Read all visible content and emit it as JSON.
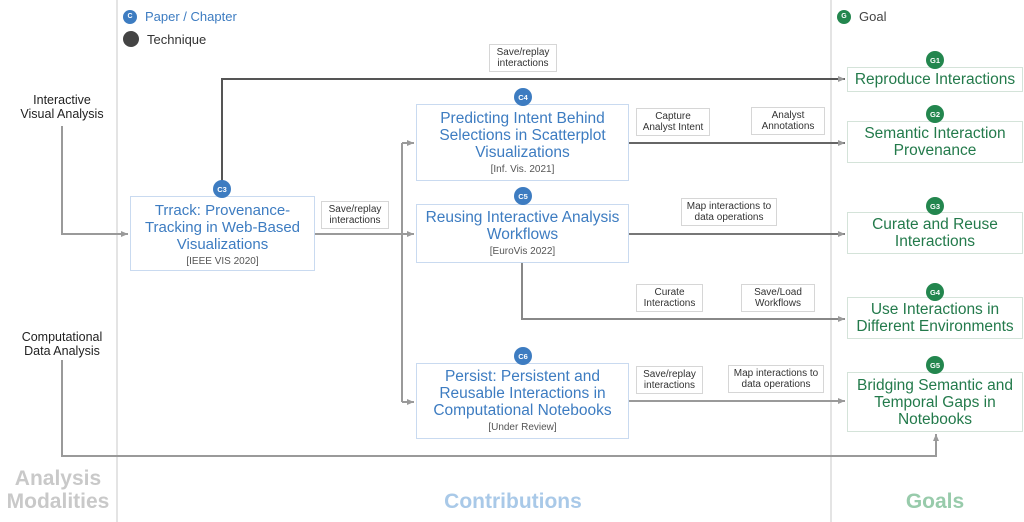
{
  "legend": {
    "paper": {
      "badge": "C",
      "label": "Paper / Chapter"
    },
    "technique": {
      "label": "Technique"
    },
    "goal": {
      "badge": "G",
      "label": "Goal"
    }
  },
  "colors": {
    "contribution": "#3d7cc1",
    "goal": "#23864e",
    "technique": "#444444",
    "edge": "#9a9a9a"
  },
  "modalities": {
    "interactive": "Interactive\nVisual Analysis",
    "computational": "Computational\nData Analysis"
  },
  "sections": {
    "modalities": "Analysis\nModalities",
    "contributions": "Contributions",
    "goals": "Goals"
  },
  "contributions": [
    {
      "id": "C3",
      "title": "Trrack: Provenance-Tracking in Web-Based Visualizations",
      "venue": "[IEEE VIS 2020]"
    },
    {
      "id": "C4",
      "title": "Predicting Intent Behind Selections in Scatterplot Visualizations",
      "venue": "[Inf. Vis. 2021]"
    },
    {
      "id": "C5",
      "title": "Reusing Interactive Analysis Workflows",
      "venue": "[EuroVis 2022]"
    },
    {
      "id": "C6",
      "title": "Persist: Persistent and Reusable Interactions in Computational Notebooks",
      "venue": "[Under Review]"
    }
  ],
  "goals": [
    {
      "id": "G1",
      "title": "Reproduce Interactions"
    },
    {
      "id": "G2",
      "title": "Semantic Interaction Provenance"
    },
    {
      "id": "G3",
      "title": "Curate and Reuse Interactions"
    },
    {
      "id": "G4",
      "title": "Use Interactions in Different Environments"
    },
    {
      "id": "G5",
      "title": "Bridging Semantic and Temporal Gaps in Notebooks"
    }
  ],
  "techniques": {
    "c3_g1_save_replay": "Save/replay interactions",
    "c3_contrib_save_replay": "Save/replay interactions",
    "c4_capture_intent": "Capture Analyst Intent",
    "c4_annotations": "Analyst Annotations",
    "c5_map_ops": "Map interactions to data operations",
    "c5_curate": "Curate Interactions",
    "c5_save_load": "Save/Load Workflows",
    "c6_save_replay": "Save/replay interactions",
    "c6_map_ops": "Map interactions to data operations"
  }
}
